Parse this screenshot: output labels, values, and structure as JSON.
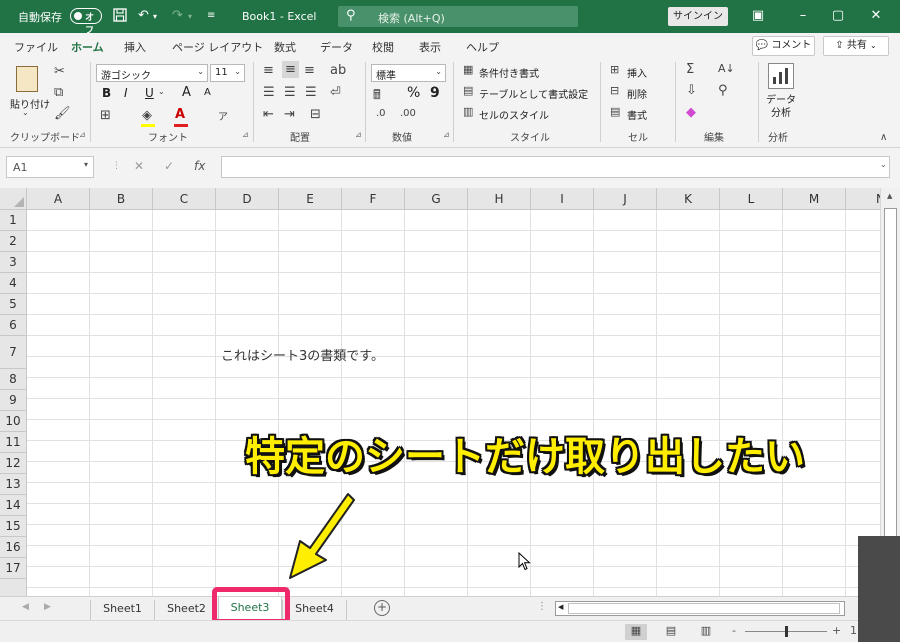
{
  "titlebar": {
    "autosave_label": "自動保存",
    "autosave_toggle": "オフ",
    "title": "Book1  -  Excel",
    "search_placeholder": "検索 (Alt+Q)",
    "signin": "サインイン"
  },
  "menu": {
    "tabs": [
      "ファイル",
      "ホーム",
      "挿入",
      "ページ レイアウト",
      "数式",
      "データ",
      "校閲",
      "表示",
      "ヘルプ"
    ],
    "active_tab": "ホーム",
    "comment": "コメント",
    "share": "共有"
  },
  "ribbon": {
    "clipboard": {
      "paste": "貼り付け",
      "label": "クリップボード"
    },
    "font": {
      "name": "游ゴシック",
      "size": "11",
      "bold": "B",
      "italic": "I",
      "underline": "U",
      "grow": "A",
      "shrink": "A",
      "label": "フォント"
    },
    "alignment": {
      "label": "配置"
    },
    "number": {
      "format": "標準",
      "label": "数値",
      "percent": "%",
      "comma": "9"
    },
    "styles": {
      "conditional": "条件付き書式",
      "table": "テーブルとして書式設定",
      "cell": "セルのスタイル",
      "label": "スタイル"
    },
    "cells": {
      "insert": "挿入",
      "delete": "削除",
      "format": "書式",
      "label": "セル"
    },
    "editing": {
      "label": "編集"
    },
    "analysis": {
      "button": "データ\n分析",
      "label": "分析"
    }
  },
  "formula_bar": {
    "namebox": "A1",
    "fx": "fx",
    "value": ""
  },
  "grid": {
    "columns": [
      "A",
      "B",
      "C",
      "D",
      "E",
      "F",
      "G",
      "H",
      "I",
      "J",
      "K",
      "L",
      "M",
      "N"
    ],
    "rows": [
      "1",
      "2",
      "3",
      "4",
      "5",
      "6",
      "7",
      "8",
      "9",
      "10",
      "11",
      "12",
      "13",
      "14",
      "15",
      "16",
      "17"
    ],
    "cell_D7": "これはシート3の書類です。"
  },
  "sheets": {
    "tabs": [
      "Sheet1",
      "Sheet2",
      "Sheet3",
      "Sheet4"
    ],
    "active": "Sheet3"
  },
  "status": {
    "zoom_minus": "-",
    "zoom_plus": "+",
    "zoom_value": "1"
  },
  "annotation": {
    "callout": "特定のシートだけ取り出したい"
  },
  "colors": {
    "brand": "#217346",
    "highlight": "#ef2a6a",
    "callout_text": "#ffee00"
  }
}
